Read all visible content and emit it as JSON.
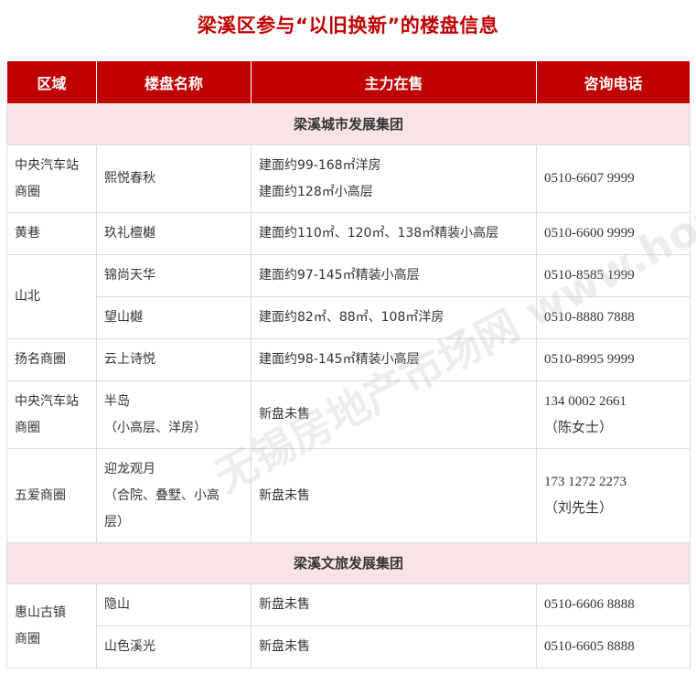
{
  "title": "梁溪区参与“以旧换新”的楼盘信息",
  "headers": [
    "区域",
    "楼盘名称",
    "主力在售",
    "咨询电话"
  ],
  "groups": [
    {
      "name": "梁溪城市发展集团",
      "rows": [
        {
          "region": [
            "中央汽车站",
            "商圈"
          ],
          "name": [
            "熙悦春秋"
          ],
          "product": [
            "建面约99-168㎡洋房",
            "建面约128㎡小高层"
          ],
          "phone": [
            "0510-6607 9999"
          ]
        },
        {
          "region": [
            "黄巷"
          ],
          "name": [
            "玖礼檀樾"
          ],
          "product": [
            "建面约110㎡、120㎡、138㎡精装小高层"
          ],
          "phone": [
            "0510-6600 9999"
          ]
        },
        {
          "region": [
            "山北"
          ],
          "name": [
            "锦尚天华"
          ],
          "product": [
            "建面约97-145㎡精装小高层"
          ],
          "phone": [
            "0510-8585 1999"
          ]
        },
        {
          "region": [],
          "name": [
            "望山樾"
          ],
          "product": [
            "建面约82㎡、88㎡、108㎡洋房"
          ],
          "phone": [
            "0510-8880 7888"
          ]
        },
        {
          "region": [
            "扬名商圈"
          ],
          "name": [
            "云上诗悦"
          ],
          "product": [
            "建面约98-145㎡精装小高层"
          ],
          "phone": [
            "0510-8995 9999"
          ]
        },
        {
          "region": [
            "中央汽车站",
            "商圈"
          ],
          "name": [
            "半岛",
            "（小高层、洋房）"
          ],
          "product": [
            "新盘未售"
          ],
          "phone": [
            "134 0002 2661",
            "（陈女士）"
          ]
        },
        {
          "region": [
            "五爱商圈"
          ],
          "name": [
            "迎龙观月",
            "（合院、叠墅、小高",
            "层）"
          ],
          "product": [
            "新盘未售"
          ],
          "phone": [
            "173 1272 2273",
            "（刘先生）"
          ]
        }
      ]
    },
    {
      "name": "梁溪文旅发展集团",
      "rows": [
        {
          "region": [
            "惠山古镇",
            "商圈"
          ],
          "name": [
            "隐山"
          ],
          "product": [
            "新盘未售"
          ],
          "phone": [
            "0510-6606 8888"
          ]
        },
        {
          "region": [],
          "name": [
            "山色溪光"
          ],
          "product": [
            "新盘未售"
          ],
          "phone": [
            "0510-6605 8888"
          ]
        }
      ]
    }
  ],
  "watermark": "无锡房地产市场网 www.house.com"
}
